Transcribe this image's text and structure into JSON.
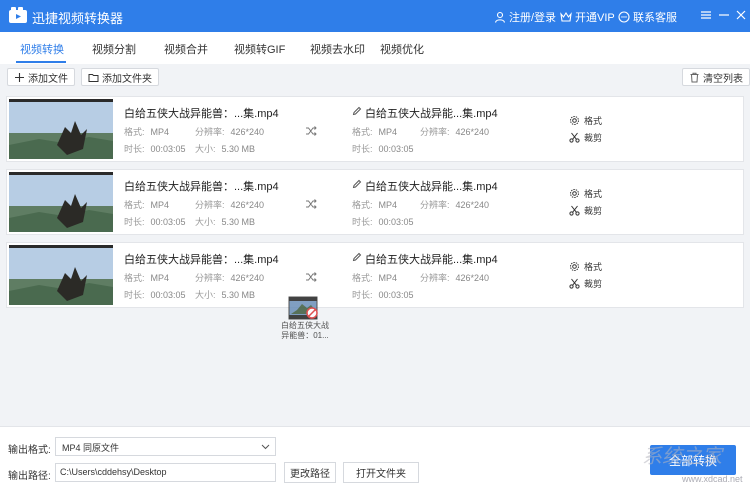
{
  "app": {
    "title": "迅捷视频转换器"
  },
  "titlebar": {
    "register_login": "注册/登录",
    "open_vip": "开通VIP",
    "contact_support": "联系客服"
  },
  "tabs": [
    {
      "label": "视频转换",
      "active": true
    },
    {
      "label": "视频分割",
      "active": false
    },
    {
      "label": "视频合并",
      "active": false
    },
    {
      "label": "视频转GIF",
      "active": false
    },
    {
      "label": "视频去水印",
      "active": false
    },
    {
      "label": "视频优化",
      "active": false
    }
  ],
  "toolbar": {
    "add_file": "添加文件",
    "add_folder": "添加文件夹",
    "clear_list": "清空列表"
  },
  "labels": {
    "format": "格式:",
    "resolution": "分辨率:",
    "duration": "时长:",
    "size": "大小:",
    "format_action": "格式",
    "cut_action": "裁剪"
  },
  "files": [
    {
      "source": {
        "name": "白给五侠大战异能兽：...集.mp4",
        "format": "MP4",
        "resolution": "426*240",
        "duration": "00:03:05",
        "size": "5.30 MB"
      },
      "output": {
        "name": "白给五侠大战异能...集.mp4",
        "format": "MP4",
        "resolution": "426*240",
        "duration": "00:03:05"
      }
    },
    {
      "source": {
        "name": "白给五侠大战异能兽：...集.mp4",
        "format": "MP4",
        "resolution": "426*240",
        "duration": "00:03:05",
        "size": "5.30 MB"
      },
      "output": {
        "name": "白给五侠大战异能...集.mp4",
        "format": "MP4",
        "resolution": "426*240",
        "duration": "00:03:05"
      }
    },
    {
      "source": {
        "name": "白给五侠大战异能兽：...集.mp4",
        "format": "MP4",
        "resolution": "426*240",
        "duration": "00:03:05",
        "size": "5.30 MB"
      },
      "output": {
        "name": "白给五侠大战异能...集.mp4",
        "format": "MP4",
        "resolution": "426*240",
        "duration": "00:03:05"
      }
    }
  ],
  "drag_ghost": {
    "line1": "白给五侠大战",
    "line2": "异能兽：01..."
  },
  "output": {
    "format_label": "输出格式:",
    "format_value": "MP4   同原文件",
    "path_label": "输出路径:",
    "path_value": "C:\\Users\\cddehsy\\Desktop",
    "change_path": "更改路径",
    "open_folder": "打开文件夹",
    "convert_all": "全部转换"
  },
  "watermark": {
    "big": "系统之家",
    "small": "www.xdcad.net"
  },
  "colors": {
    "accent": "#2f7ee9",
    "background": "#f1f3f6"
  }
}
